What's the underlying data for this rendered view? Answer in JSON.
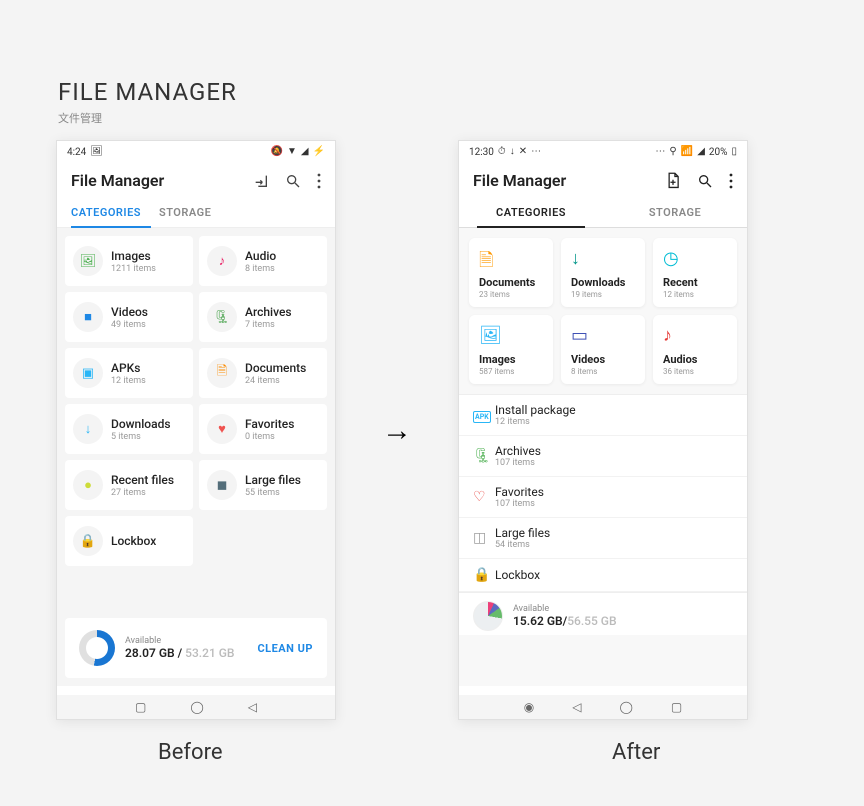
{
  "heading": {
    "title": "FILE MANAGER",
    "subtitle": "文件管理"
  },
  "labels": {
    "before": "Before",
    "after": "After"
  },
  "before": {
    "status": {
      "time": "4:24",
      "left_icons": [
        "🖼"
      ],
      "right_icons": [
        "🔕",
        "▼",
        "◢",
        "⚡"
      ]
    },
    "appbar": {
      "title": "File Manager"
    },
    "tabs": {
      "categories": "CATEGORIES",
      "storage": "STORAGE"
    },
    "cards": [
      {
        "label": "Images",
        "count": "1211 items",
        "icon": "🖼",
        "color": "#4caf50"
      },
      {
        "label": "Audio",
        "count": "8 items",
        "icon": "♪",
        "color": "#e91e63"
      },
      {
        "label": "Videos",
        "count": "49 items",
        "icon": "■",
        "color": "#1e88e5"
      },
      {
        "label": "Archives",
        "count": "7 items",
        "icon": "🗜",
        "color": "#43a047"
      },
      {
        "label": "APKs",
        "count": "12 items",
        "icon": "▣",
        "color": "#29b6f6"
      },
      {
        "label": "Documents",
        "count": "24 items",
        "icon": "🗎",
        "color": "#fb8c00"
      },
      {
        "label": "Downloads",
        "count": "5 items",
        "icon": "↓",
        "color": "#29b6f6"
      },
      {
        "label": "Favorites",
        "count": "0 items",
        "icon": "♥",
        "color": "#ef5350"
      },
      {
        "label": "Recent files",
        "count": "27 items",
        "icon": "●",
        "color": "#cddc39"
      },
      {
        "label": "Large files",
        "count": "55 items",
        "icon": "◼",
        "color": "#546e7a"
      },
      {
        "label": "Lockbox",
        "count": "",
        "icon": "🔒",
        "color": "#009688"
      }
    ],
    "storage": {
      "available_label": "Available",
      "used": "28.07 GB",
      "sep": " / ",
      "total": "53.21 GB",
      "clean": "CLEAN UP"
    }
  },
  "after": {
    "status": {
      "time": "12:30",
      "left_icons": [
        "⏱",
        "↓",
        "✕",
        "⋯"
      ],
      "right_icons": [
        "⋯",
        "⚲",
        "📶",
        "◢",
        "20%",
        "▯"
      ]
    },
    "appbar": {
      "title": "File Manager"
    },
    "tabs": {
      "categories": "CATEGORIES",
      "storage": "STORAGE"
    },
    "cards": [
      {
        "label": "Documents",
        "count": "23 items",
        "icon": "🗎",
        "color": "#ff9800"
      },
      {
        "label": "Downloads",
        "count": "19 items",
        "icon": "↓",
        "color": "#009688"
      },
      {
        "label": "Recent",
        "count": "12 items",
        "icon": "◷",
        "color": "#00bcd4"
      },
      {
        "label": "Images",
        "count": "587 items",
        "icon": "🖼",
        "color": "#29b6f6"
      },
      {
        "label": "Videos",
        "count": "8 items",
        "icon": "▭",
        "color": "#3f51b5"
      },
      {
        "label": "Audios",
        "count": "36 items",
        "icon": "♪",
        "color": "#e53935"
      }
    ],
    "rows": [
      {
        "label": "Install package",
        "count": "12 items",
        "icon": "APK",
        "color": "#29b6f6"
      },
      {
        "label": "Archives",
        "count": "107 items",
        "icon": "🗜",
        "color": "#4caf50"
      },
      {
        "label": "Favorites",
        "count": "107 items",
        "icon": "♡",
        "color": "#e53935"
      },
      {
        "label": "Large files",
        "count": "54 items",
        "icon": "◫",
        "color": "#9e9e9e"
      },
      {
        "label": "Lockbox",
        "count": "",
        "icon": "🔒",
        "color": "#9e9e9e"
      }
    ],
    "storage": {
      "available_label": "Available",
      "used": "15.62 GB",
      "sep": "/",
      "total": "56.55 GB"
    }
  }
}
